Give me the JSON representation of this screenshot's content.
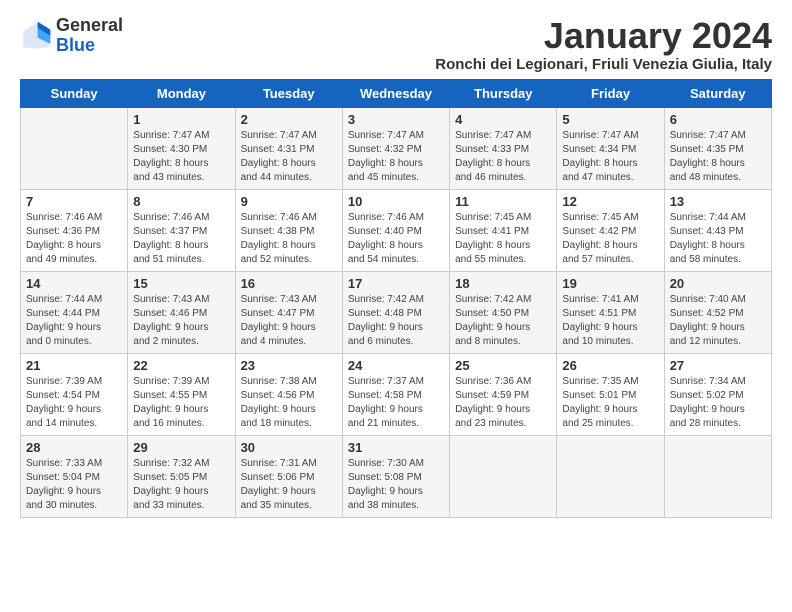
{
  "logo": {
    "general": "General",
    "blue": "Blue"
  },
  "title": "January 2024",
  "subtitle": "Ronchi dei Legionari, Friuli Venezia Giulia, Italy",
  "headers": [
    "Sunday",
    "Monday",
    "Tuesday",
    "Wednesday",
    "Thursday",
    "Friday",
    "Saturday"
  ],
  "weeks": [
    [
      {
        "day": "",
        "content": ""
      },
      {
        "day": "1",
        "content": "Sunrise: 7:47 AM\nSunset: 4:30 PM\nDaylight: 8 hours\nand 43 minutes."
      },
      {
        "day": "2",
        "content": "Sunrise: 7:47 AM\nSunset: 4:31 PM\nDaylight: 8 hours\nand 44 minutes."
      },
      {
        "day": "3",
        "content": "Sunrise: 7:47 AM\nSunset: 4:32 PM\nDaylight: 8 hours\nand 45 minutes."
      },
      {
        "day": "4",
        "content": "Sunrise: 7:47 AM\nSunset: 4:33 PM\nDaylight: 8 hours\nand 46 minutes."
      },
      {
        "day": "5",
        "content": "Sunrise: 7:47 AM\nSunset: 4:34 PM\nDaylight: 8 hours\nand 47 minutes."
      },
      {
        "day": "6",
        "content": "Sunrise: 7:47 AM\nSunset: 4:35 PM\nDaylight: 8 hours\nand 48 minutes."
      }
    ],
    [
      {
        "day": "7",
        "content": "Sunrise: 7:46 AM\nSunset: 4:36 PM\nDaylight: 8 hours\nand 49 minutes."
      },
      {
        "day": "8",
        "content": "Sunrise: 7:46 AM\nSunset: 4:37 PM\nDaylight: 8 hours\nand 51 minutes."
      },
      {
        "day": "9",
        "content": "Sunrise: 7:46 AM\nSunset: 4:38 PM\nDaylight: 8 hours\nand 52 minutes."
      },
      {
        "day": "10",
        "content": "Sunrise: 7:46 AM\nSunset: 4:40 PM\nDaylight: 8 hours\nand 54 minutes."
      },
      {
        "day": "11",
        "content": "Sunrise: 7:45 AM\nSunset: 4:41 PM\nDaylight: 8 hours\nand 55 minutes."
      },
      {
        "day": "12",
        "content": "Sunrise: 7:45 AM\nSunset: 4:42 PM\nDaylight: 8 hours\nand 57 minutes."
      },
      {
        "day": "13",
        "content": "Sunrise: 7:44 AM\nSunset: 4:43 PM\nDaylight: 8 hours\nand 58 minutes."
      }
    ],
    [
      {
        "day": "14",
        "content": "Sunrise: 7:44 AM\nSunset: 4:44 PM\nDaylight: 9 hours\nand 0 minutes."
      },
      {
        "day": "15",
        "content": "Sunrise: 7:43 AM\nSunset: 4:46 PM\nDaylight: 9 hours\nand 2 minutes."
      },
      {
        "day": "16",
        "content": "Sunrise: 7:43 AM\nSunset: 4:47 PM\nDaylight: 9 hours\nand 4 minutes."
      },
      {
        "day": "17",
        "content": "Sunrise: 7:42 AM\nSunset: 4:48 PM\nDaylight: 9 hours\nand 6 minutes."
      },
      {
        "day": "18",
        "content": "Sunrise: 7:42 AM\nSunset: 4:50 PM\nDaylight: 9 hours\nand 8 minutes."
      },
      {
        "day": "19",
        "content": "Sunrise: 7:41 AM\nSunset: 4:51 PM\nDaylight: 9 hours\nand 10 minutes."
      },
      {
        "day": "20",
        "content": "Sunrise: 7:40 AM\nSunset: 4:52 PM\nDaylight: 9 hours\nand 12 minutes."
      }
    ],
    [
      {
        "day": "21",
        "content": "Sunrise: 7:39 AM\nSunset: 4:54 PM\nDaylight: 9 hours\nand 14 minutes."
      },
      {
        "day": "22",
        "content": "Sunrise: 7:39 AM\nSunset: 4:55 PM\nDaylight: 9 hours\nand 16 minutes."
      },
      {
        "day": "23",
        "content": "Sunrise: 7:38 AM\nSunset: 4:56 PM\nDaylight: 9 hours\nand 18 minutes."
      },
      {
        "day": "24",
        "content": "Sunrise: 7:37 AM\nSunset: 4:58 PM\nDaylight: 9 hours\nand 21 minutes."
      },
      {
        "day": "25",
        "content": "Sunrise: 7:36 AM\nSunset: 4:59 PM\nDaylight: 9 hours\nand 23 minutes."
      },
      {
        "day": "26",
        "content": "Sunrise: 7:35 AM\nSunset: 5:01 PM\nDaylight: 9 hours\nand 25 minutes."
      },
      {
        "day": "27",
        "content": "Sunrise: 7:34 AM\nSunset: 5:02 PM\nDaylight: 9 hours\nand 28 minutes."
      }
    ],
    [
      {
        "day": "28",
        "content": "Sunrise: 7:33 AM\nSunset: 5:04 PM\nDaylight: 9 hours\nand 30 minutes."
      },
      {
        "day": "29",
        "content": "Sunrise: 7:32 AM\nSunset: 5:05 PM\nDaylight: 9 hours\nand 33 minutes."
      },
      {
        "day": "30",
        "content": "Sunrise: 7:31 AM\nSunset: 5:06 PM\nDaylight: 9 hours\nand 35 minutes."
      },
      {
        "day": "31",
        "content": "Sunrise: 7:30 AM\nSunset: 5:08 PM\nDaylight: 9 hours\nand 38 minutes."
      },
      {
        "day": "",
        "content": ""
      },
      {
        "day": "",
        "content": ""
      },
      {
        "day": "",
        "content": ""
      }
    ]
  ]
}
